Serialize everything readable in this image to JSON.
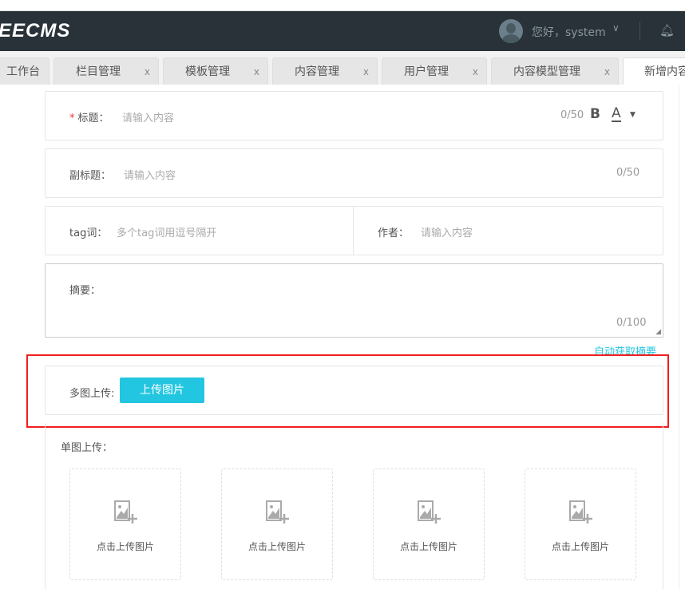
{
  "header": {
    "logo": "EECMS",
    "greeting": "您好，system"
  },
  "tabs": [
    {
      "label": "工作台"
    },
    {
      "label": "栏目管理",
      "close": "x"
    },
    {
      "label": "模板管理",
      "close": "x"
    },
    {
      "label": "内容管理",
      "close": "x"
    },
    {
      "label": "用户管理",
      "close": "x"
    },
    {
      "label": "内容模型管理",
      "close": "x"
    },
    {
      "label": "新增内容"
    }
  ],
  "form": {
    "title": {
      "required": "*",
      "label": "标题：",
      "placeholder": "请输入内容",
      "count": "0/50",
      "bold": "B",
      "color": "A"
    },
    "subtitle": {
      "label": "副标题：",
      "placeholder": "请输入内容",
      "count": "0/50"
    },
    "tag": {
      "label": "tag词：",
      "placeholder": "多个tag词用逗号隔开"
    },
    "author": {
      "label": "作者：",
      "placeholder": "请输入内容"
    },
    "summary": {
      "label": "摘要：",
      "count": "0/100",
      "auto_link": "自动获取摘要"
    },
    "multi_upload": {
      "label": "多图上传:",
      "button": "上传图片"
    },
    "single_upload": {
      "label": "单图上传：",
      "cards": [
        {
          "text": "点击上传图片"
        },
        {
          "text": "点击上传图片"
        },
        {
          "text": "点击上传图片"
        },
        {
          "text": "点击上传图片"
        }
      ]
    }
  }
}
